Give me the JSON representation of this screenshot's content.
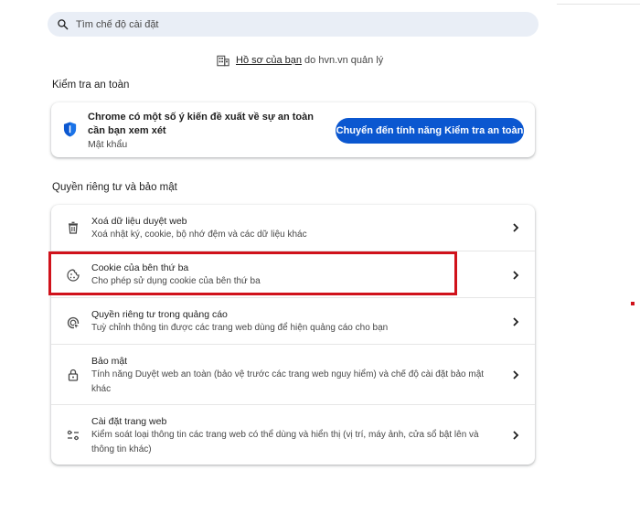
{
  "search": {
    "placeholder": "Tìm chế độ cài đặt"
  },
  "managed": {
    "link": "Hồ sơ của bạn",
    "suffix": "do hvn.vn quản lý"
  },
  "safety_check": {
    "heading": "Kiểm tra an toàn",
    "title": "Chrome có một số ý kiến đề xuất về sự an toàn cần bạn xem xét",
    "subtitle": "Mật khẩu",
    "button": "Chuyển đến tính năng Kiểm tra an toàn"
  },
  "privacy": {
    "heading": "Quyền riêng tư và bảo mật",
    "items": [
      {
        "title": "Xoá dữ liệu duyệt web",
        "description": "Xoá nhật ký, cookie, bộ nhớ đệm và các dữ liệu khác",
        "icon": "trash-icon"
      },
      {
        "title": "Cookie của bên thứ ba",
        "description": "Cho phép sử dụng cookie của bên thứ ba",
        "icon": "cookie-icon"
      },
      {
        "title": "Quyền riêng tư trong quảng cáo",
        "description": "Tuỳ chỉnh thông tin được các trang web dùng để hiện quảng cáo cho bạn",
        "icon": "ad-privacy-icon"
      },
      {
        "title": "Bảo mật",
        "description": "Tính năng Duyệt web an toàn (bảo vệ trước các trang web nguy hiểm) và chế độ cài đặt bảo mật khác",
        "icon": "lock-icon"
      },
      {
        "title": "Cài đặt trang web",
        "description": "Kiểm soát loại thông tin các trang web có thể dùng và hiển thị (vị trí, máy ảnh, cửa sổ bật lên và thông tin khác)",
        "icon": "tune-icon"
      }
    ]
  },
  "colors": {
    "accent": "#0b57d0",
    "highlight": "#d0121b",
    "search_bg": "#e9eef6"
  }
}
